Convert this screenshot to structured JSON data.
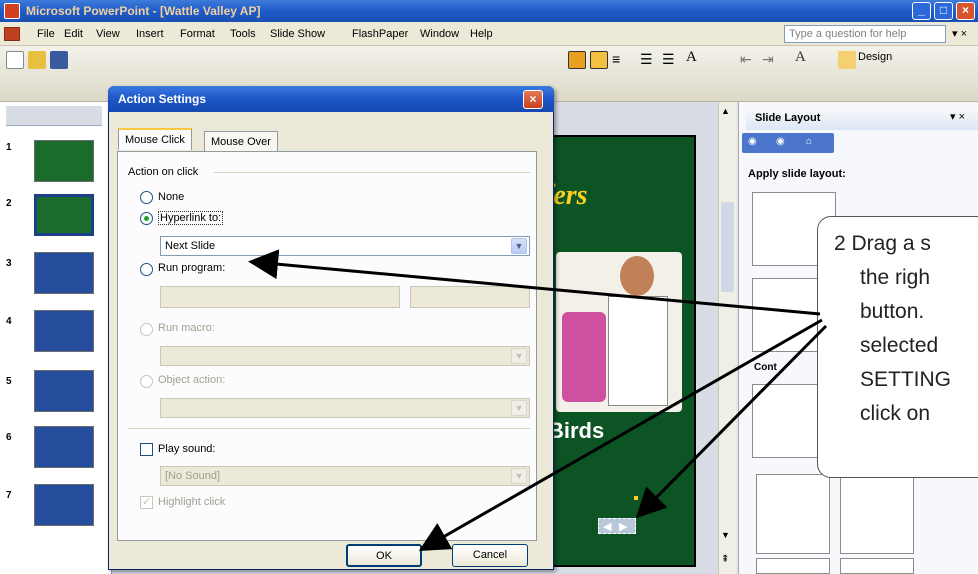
{
  "window": {
    "title": "Microsoft PowerPoint - [Wattle Valley AP]",
    "minimize_label": "_",
    "maximize_label": "□",
    "close_label": "×"
  },
  "menu": {
    "items": [
      "File",
      "Edit",
      "View",
      "Insert",
      "Format",
      "Tools",
      "Slide Show",
      "FlashPaper",
      "Window",
      "Help"
    ],
    "help_placeholder": "Type a question for help"
  },
  "toolbar": {
    "design_label": "Design"
  },
  "slide_pane": {
    "numbers": [
      "1",
      "2",
      "3",
      "4",
      "5",
      "6",
      "7"
    ]
  },
  "slide": {
    "title_fragment": "fers",
    "caption_fragment": "Birds"
  },
  "task_pane": {
    "title": "Slide Layout",
    "apply_label": "Apply slide layout:",
    "content_fragment": "Cont"
  },
  "dialog": {
    "title": "Action Settings",
    "tabs": [
      "Mouse Click",
      "Mouse Over"
    ],
    "group_label": "Action on click",
    "options": {
      "none": "None",
      "hyperlink": "Hyperlink to:",
      "hyperlink_value": "Next Slide",
      "run_program": "Run program:",
      "run_macro": "Run macro:",
      "object_action": "Object action:"
    },
    "play_sound": "Play sound:",
    "sound_value": "[No Sound]",
    "highlight_click": "Highlight click",
    "ok": "OK",
    "cancel": "Cancel"
  },
  "callout": {
    "lines": [
      "2  Drag a s",
      "the righ",
      "button.",
      "selected",
      "SETTING",
      "click on"
    ]
  },
  "colors": {
    "title_bar": "#1f5cc9",
    "slide_bg": "#0c5424",
    "slide_title": "#ffd020",
    "arrow": "#000000"
  }
}
